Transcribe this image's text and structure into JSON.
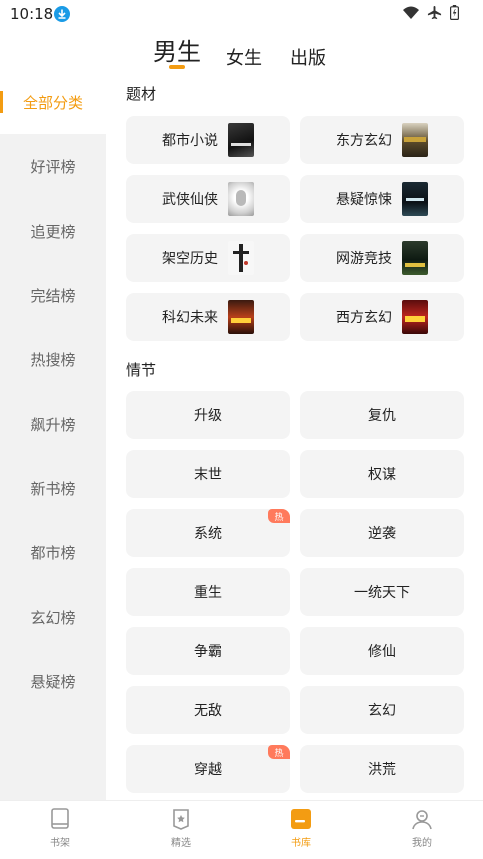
{
  "status": {
    "time": "10:18"
  },
  "gender_tabs": [
    {
      "label": "男生",
      "active": true
    },
    {
      "label": "女生",
      "active": false
    },
    {
      "label": "出版",
      "active": false
    }
  ],
  "sidebar": {
    "items": [
      {
        "label": "全部分类",
        "active": true
      },
      {
        "label": "好评榜"
      },
      {
        "label": "追更榜"
      },
      {
        "label": "完结榜"
      },
      {
        "label": "热搜榜"
      },
      {
        "label": "飙升榜"
      },
      {
        "label": "新书榜"
      },
      {
        "label": "都市榜"
      },
      {
        "label": "玄幻榜"
      },
      {
        "label": "悬疑榜"
      }
    ]
  },
  "sections": {
    "theme": {
      "title": "题材",
      "items": [
        {
          "label": "都市小说",
          "cover": "dark"
        },
        {
          "label": "东方玄幻",
          "cover": "gold"
        },
        {
          "label": "武侠仙侠",
          "cover": "white"
        },
        {
          "label": "悬疑惊悚",
          "cover": "night"
        },
        {
          "label": "架空历史",
          "cover": "ink"
        },
        {
          "label": "网游竞技",
          "cover": "green"
        },
        {
          "label": "科幻未来",
          "cover": "fire"
        },
        {
          "label": "西方玄幻",
          "cover": "red"
        }
      ]
    },
    "plot": {
      "title": "情节",
      "hot_label": "热",
      "items": [
        {
          "label": "升级"
        },
        {
          "label": "复仇"
        },
        {
          "label": "末世"
        },
        {
          "label": "权谋"
        },
        {
          "label": "系统",
          "hot": true
        },
        {
          "label": "逆袭"
        },
        {
          "label": "重生"
        },
        {
          "label": "一统天下"
        },
        {
          "label": "争霸"
        },
        {
          "label": "修仙"
        },
        {
          "label": "无敌"
        },
        {
          "label": "玄幻"
        },
        {
          "label": "穿越",
          "hot": true
        },
        {
          "label": "洪荒"
        }
      ]
    }
  },
  "bottom_nav": [
    {
      "label": "书架",
      "icon": "bookshelf-icon",
      "active": false
    },
    {
      "label": "精选",
      "icon": "featured-icon",
      "active": false
    },
    {
      "label": "书库",
      "icon": "library-icon",
      "active": true
    },
    {
      "label": "我的",
      "icon": "profile-icon",
      "active": false
    }
  ],
  "colors": {
    "accent": "#f39c12",
    "hot": "#ff7a5c",
    "card_bg": "#f4f4f4",
    "sidebar_bg": "#f2f2f2"
  }
}
